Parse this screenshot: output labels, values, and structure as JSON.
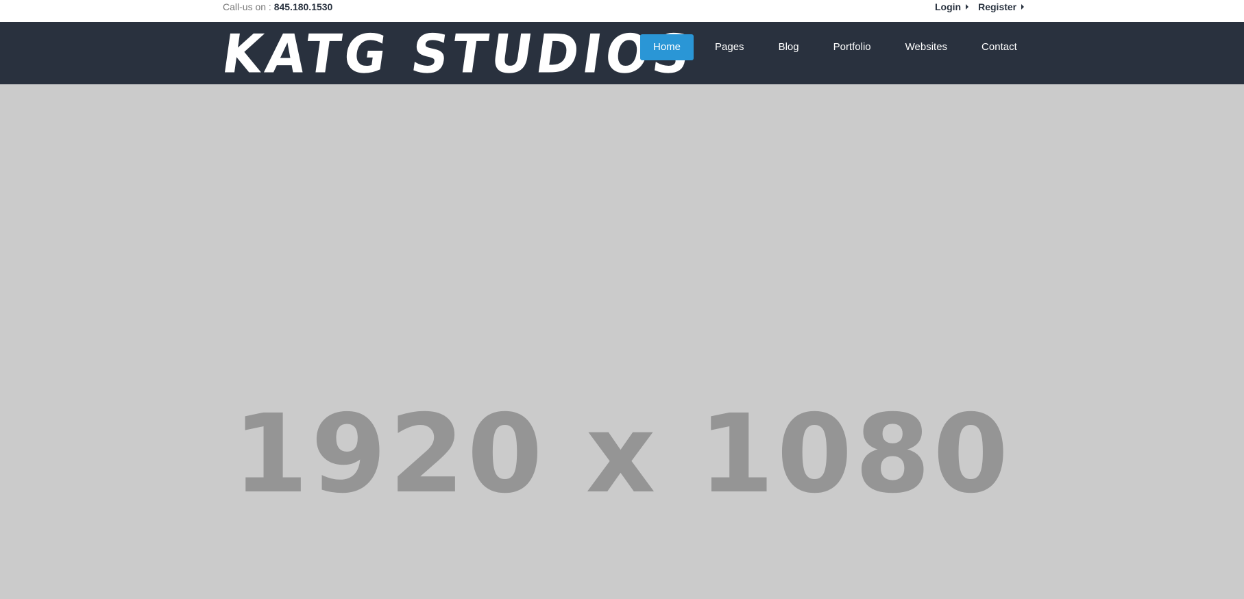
{
  "topbar": {
    "call_label": "Call-us on : ",
    "phone": "845.180.1530",
    "login": "Login",
    "register": "Register"
  },
  "brand": {
    "logo_text": "KATG STUDIOS"
  },
  "nav": {
    "items": [
      {
        "label": "Home",
        "active": true
      },
      {
        "label": "Pages"
      },
      {
        "label": "Blog"
      },
      {
        "label": "Portfolio"
      },
      {
        "label": "Websites"
      },
      {
        "label": "Contact"
      }
    ]
  },
  "hero": {
    "placeholder_text": "1920 x 1080"
  },
  "colors": {
    "navbar_bg": "#29313e",
    "active_nav": "#2a96d6",
    "hero_bg": "#cbcbcb",
    "placeholder_text": "#959595"
  },
  "icons": {
    "login_caret": "caret-right-icon",
    "register_caret": "caret-right-icon"
  }
}
